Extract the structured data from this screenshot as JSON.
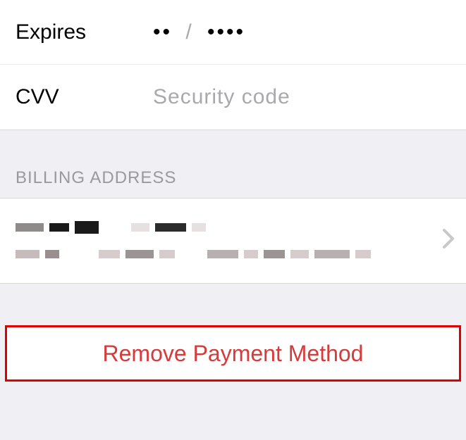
{
  "card": {
    "expires_label": "Expires",
    "expires_mm": "••",
    "expires_sep": "/",
    "expires_yyyy": "••••",
    "cvv_label": "CVV",
    "cvv_placeholder": "Security code"
  },
  "billing": {
    "header": "BILLING ADDRESS"
  },
  "actions": {
    "remove_label": "Remove Payment Method"
  },
  "colors": {
    "destructive": "#d73a3a",
    "highlight": "#e10000"
  }
}
